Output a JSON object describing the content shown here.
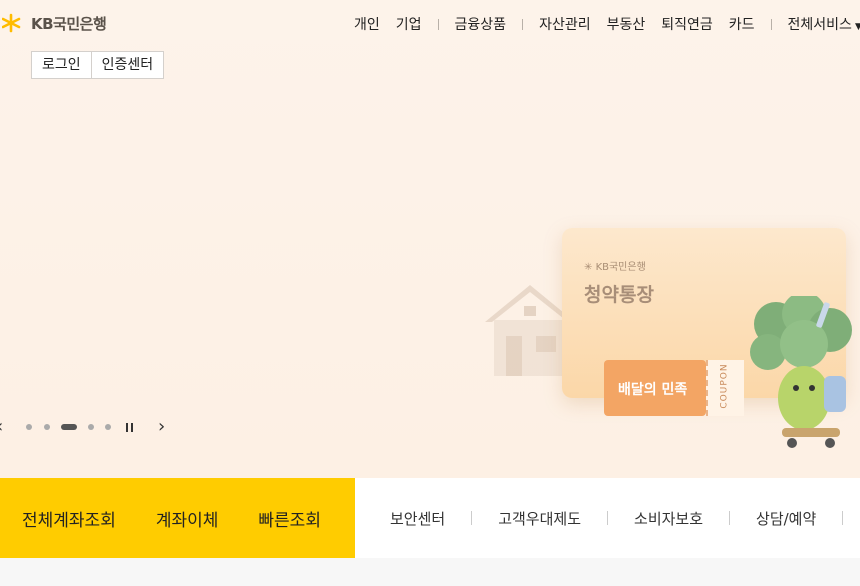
{
  "brand": {
    "name": "KB국민은행",
    "color": "#ffbc00"
  },
  "gnb": {
    "items": [
      "개인",
      "기업",
      "금융상품",
      "자산관리",
      "부동산",
      "퇴직연금",
      "카드",
      "전체서비스"
    ]
  },
  "auth": {
    "login": "로그인",
    "cert_center": "인증센터"
  },
  "banner": {
    "card_logo": "KB국민은행",
    "card_title": "청약통장",
    "coupon_label": "배달의 민족",
    "coupon_stub": "COUPON",
    "current_slide": 3,
    "total_slides": 5
  },
  "quick_menu": [
    "전체계좌조회",
    "계좌이체",
    "빠른조회"
  ],
  "sub_menu": [
    "보안센터",
    "고객우대제도",
    "소비자보호",
    "상담/예약"
  ],
  "colors": {
    "accent": "#ffcc00",
    "hero_bg": "#fdf3ea",
    "coupon": "#f3a564"
  }
}
